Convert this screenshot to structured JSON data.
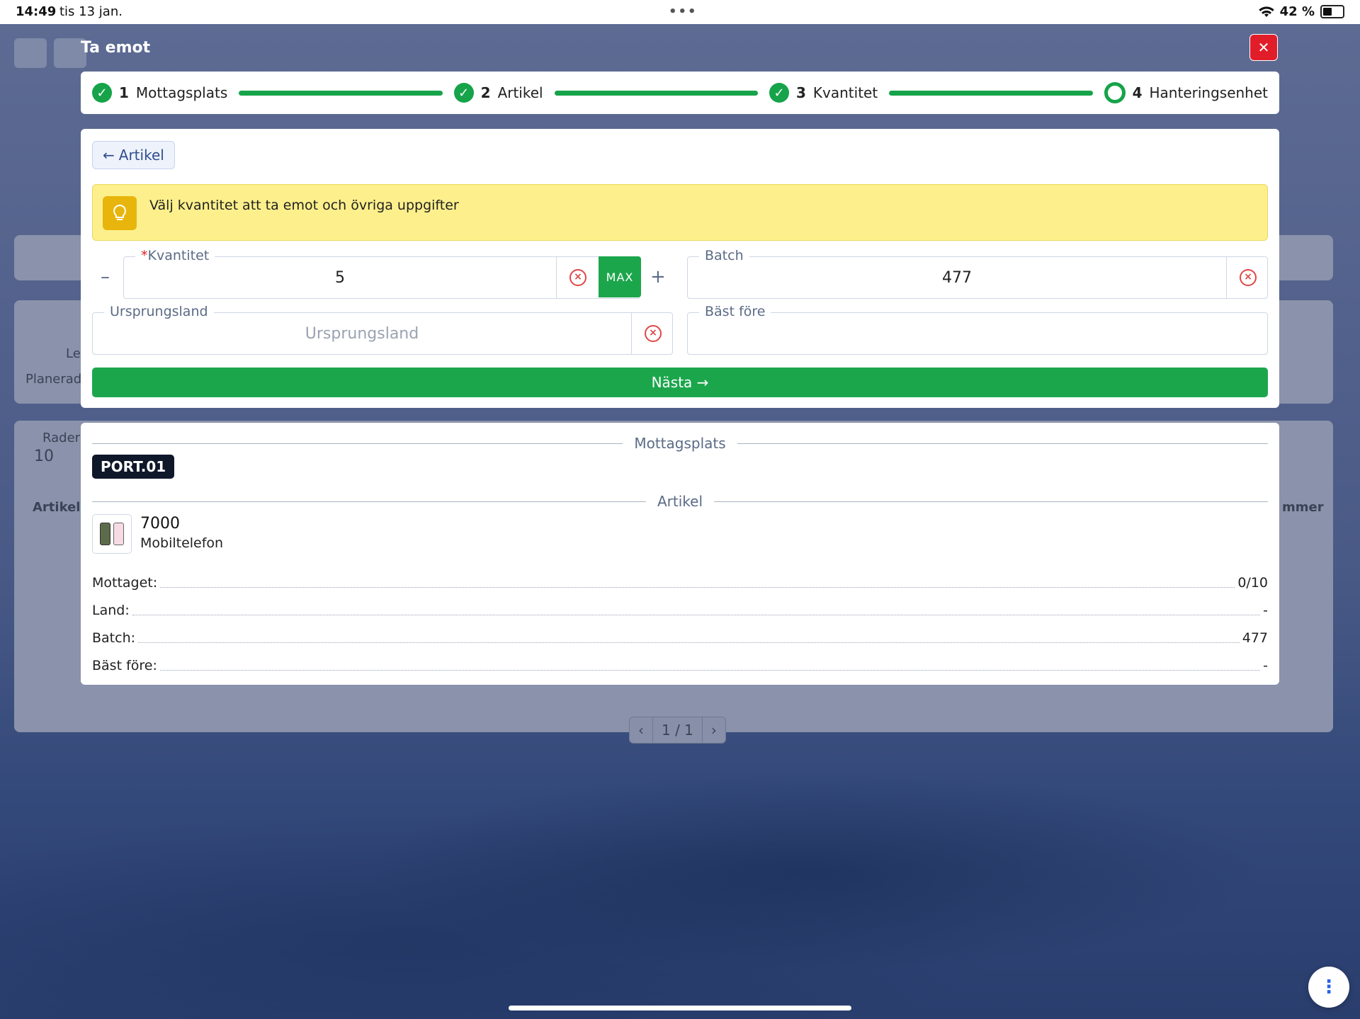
{
  "status_bar": {
    "time": "14:49",
    "date": "tis 13 jan.",
    "dots": "•••",
    "battery": "42 %"
  },
  "background": {
    "left_labels": [
      "Le",
      "Planerad"
    ],
    "rows_label": "Rader",
    "rows_value": "10",
    "table_header_left": "Artikel",
    "table_header_right": "mmer",
    "pager": {
      "prev": "‹",
      "page": "1 / 1",
      "next": "›"
    }
  },
  "modal": {
    "title": "Ta emot",
    "close_icon": "close-icon",
    "steps": [
      {
        "num": "1",
        "label": "Mottagsplats",
        "state": "done"
      },
      {
        "num": "2",
        "label": "Artikel",
        "state": "done"
      },
      {
        "num": "3",
        "label": "Kvantitet",
        "state": "done"
      },
      {
        "num": "4",
        "label": "Hanteringsenhet",
        "state": "current"
      }
    ],
    "back_label": "Artikel",
    "hint": "Välj kvantitet att ta emot och övriga uppgifter",
    "fields": {
      "quantity": {
        "required_mark": "*",
        "label": "Kvantitet",
        "value": "5",
        "minus": "–",
        "plus": "+",
        "max": "MAX"
      },
      "batch": {
        "label": "Batch",
        "value": "477"
      },
      "origin": {
        "label": "Ursprungsland",
        "placeholder": "Ursprungsland"
      },
      "best_before": {
        "label": "Bäst före",
        "value": ""
      }
    },
    "next_label": "Nästa →"
  },
  "summary": {
    "location_header": "Mottagsplats",
    "location": "PORT.01",
    "article_header": "Artikel",
    "article_number": "7000",
    "article_name": "Mobiltelefon",
    "rows": [
      {
        "key": "Mottaget:",
        "value": "0/10"
      },
      {
        "key": "Land:",
        "value": "-"
      },
      {
        "key": "Batch:",
        "value": "477"
      },
      {
        "key": "Bäst före:",
        "value": "-"
      }
    ]
  },
  "colors": {
    "accent": "#1ca64c",
    "danger": "#e11d2a",
    "hint_bg": "#fdf08c",
    "tag_bg": "#0f172a"
  }
}
